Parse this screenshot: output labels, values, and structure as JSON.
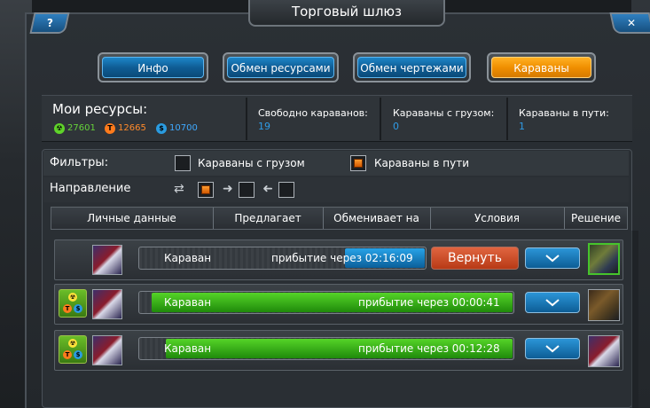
{
  "window": {
    "title": "Торговый шлюз",
    "help_label": "?",
    "close_label": "✕"
  },
  "tabs": [
    {
      "label": "Инфо",
      "active": false
    },
    {
      "label": "Обмен ресурсами",
      "active": false
    },
    {
      "label": "Обмен чертежами",
      "active": false
    },
    {
      "label": "Караваны",
      "active": true
    }
  ],
  "resources": {
    "label": "Мои ресурсы:",
    "green": {
      "icon": "radiation-icon",
      "value": "27601",
      "color": "#66d23a"
    },
    "orange": {
      "icon": "titanium-icon",
      "value": "12665",
      "color": "#ff8a2a"
    },
    "blue": {
      "icon": "credits-icon",
      "value": "10700",
      "color": "#3fa9ff"
    }
  },
  "stats": [
    {
      "label": "Свободно караванов:",
      "value": "19"
    },
    {
      "label": "Караваны с грузом:",
      "value": "0"
    },
    {
      "label": "Караваны в пути:",
      "value": "1"
    }
  ],
  "filters": {
    "label": "Фильтры:",
    "with_cargo": {
      "label": "Караваны с грузом",
      "checked": false
    },
    "in_transit": {
      "label": "Караваны в пути",
      "checked": true
    }
  },
  "direction": {
    "label": "Направление",
    "options": [
      {
        "icon": "both-directions-icon",
        "checked": true
      },
      {
        "icon": "arrow-right-icon",
        "checked": false
      },
      {
        "icon": "arrow-left-icon",
        "checked": false
      }
    ]
  },
  "table": {
    "columns": [
      "Личные данные",
      "Предлагает",
      "Обменивает на",
      "Условия",
      "Решение"
    ]
  },
  "caravans": [
    {
      "name": "Караван",
      "status": "прибытие через 02:16:09",
      "progress": 0.28,
      "bar_color": "blue",
      "action": "Вернуть",
      "has_resource_badge": false
    },
    {
      "name": "Караван",
      "status": "прибытие через 00:00:41",
      "progress": 0.97,
      "bar_color": "green",
      "action": "",
      "has_resource_badge": true
    },
    {
      "name": "Караван",
      "status": "прибытие через 00:12:28",
      "progress": 0.93,
      "bar_color": "green",
      "action": "",
      "has_resource_badge": true
    }
  ],
  "colors": {
    "accent_blue": "#1d86c9",
    "accent_orange": "#f08f00",
    "return_red": "#c9461f",
    "value_blue": "#2f9be6"
  }
}
